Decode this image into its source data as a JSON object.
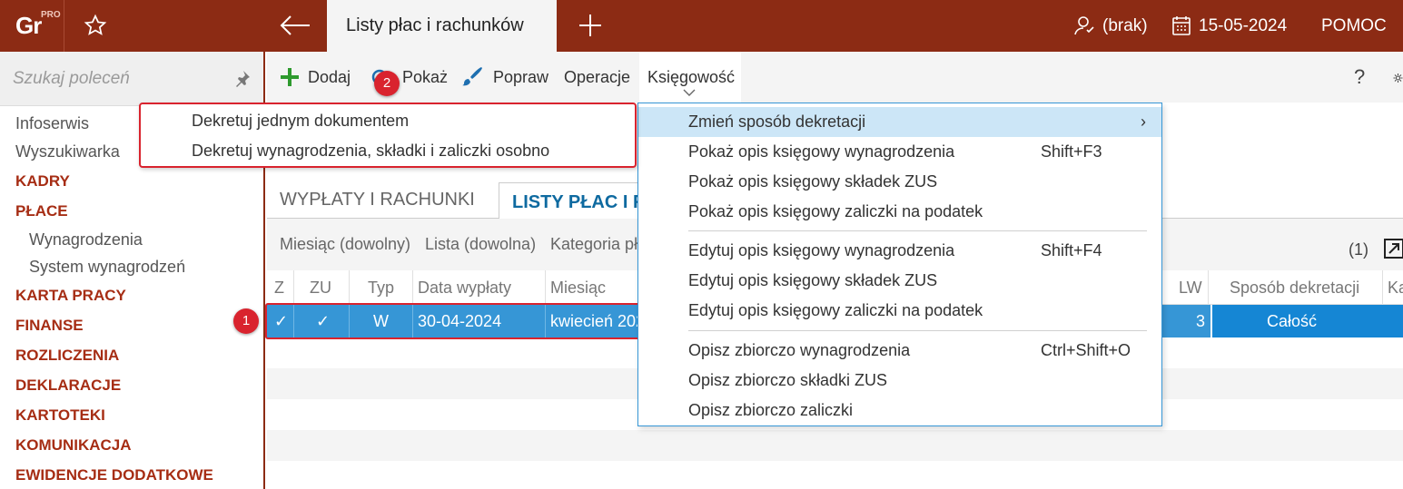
{
  "topbar": {
    "logo_main": "Gr",
    "logo_badge": "PRO",
    "active_tab": "Listy płac i rachunków",
    "user": "(brak)",
    "date": "15-05-2024",
    "help": "POMOC"
  },
  "sidebar": {
    "search_placeholder": "Szukaj poleceń",
    "items": [
      {
        "label": "Infoserwis"
      },
      {
        "label": "Wyszukiwarka"
      },
      {
        "label": "KADRY"
      },
      {
        "label": "PŁACE"
      },
      {
        "label": "Wynagrodzenia"
      },
      {
        "label": "System wynagrodzeń"
      },
      {
        "label": "KARTA PRACY"
      },
      {
        "label": "FINANSE"
      },
      {
        "label": "ROZLICZENIA"
      },
      {
        "label": "DEKLARACJE"
      },
      {
        "label": "KARTOTEKI"
      },
      {
        "label": "KOMUNIKACJA"
      },
      {
        "label": "EWIDENCJE DODATKOWE"
      }
    ]
  },
  "toolbar": {
    "add": "Dodaj",
    "show": "Pokaż",
    "edit": "Popraw",
    "operations": "Operacje",
    "accounting": "Księgowość",
    "help": "?"
  },
  "tabs": {
    "payments": "WYPŁATY I RACHUNKI",
    "lists": "LISTY PŁAC I R"
  },
  "filters": {
    "month": "Miesiąc (dowolny)",
    "list": "Lista (dowolna)",
    "category": "Kategoria pł",
    "count": "(1)"
  },
  "grid": {
    "headers": {
      "z": "Z",
      "zu": "ZU",
      "type": "Typ",
      "payment_date": "Data wypłaty",
      "month": "Miesiąc",
      "lw": "LW",
      "method": "Sposób dekretacji",
      "k": "Ka"
    },
    "row": {
      "z": "✓",
      "zu": "✓",
      "type": "W",
      "payment_date": "30-04-2024",
      "month": "kwiecień 202",
      "lw": "3",
      "method": "Całość"
    }
  },
  "menu": {
    "items": [
      {
        "label": "Zmień sposób dekretacji",
        "shortcut": "",
        "submenu": "›"
      },
      {
        "label": "Pokaż opis księgowy wynagrodzenia",
        "shortcut": "Shift+F3"
      },
      {
        "label": "Pokaż opis księgowy składek ZUS",
        "shortcut": ""
      },
      {
        "label": "Pokaż opis księgowy zaliczki na podatek",
        "shortcut": ""
      },
      {
        "label": "Edytuj opis księgowy wynagrodzenia",
        "shortcut": "Shift+F4"
      },
      {
        "label": "Edytuj opis księgowy składek ZUS",
        "shortcut": ""
      },
      {
        "label": "Edytuj opis księgowy zaliczki na podatek",
        "shortcut": ""
      },
      {
        "label": "Opisz zbiorczo wynagrodzenia",
        "shortcut": "Ctrl+Shift+O"
      },
      {
        "label": "Opisz zbiorczo składki ZUS",
        "shortcut": ""
      },
      {
        "label": "Opisz zbiorczo zaliczki",
        "shortcut": ""
      }
    ]
  },
  "submenu": {
    "items": [
      {
        "label": "Dekretuj jednym dokumentem"
      },
      {
        "label": "Dekretuj wynagrodzenia, składki i zaliczki osobno"
      }
    ]
  },
  "badges": {
    "one": "1",
    "two": "2"
  },
  "colors": {
    "brand": "#8c2b14",
    "accent": "#a62d14",
    "selection": "#3696d6",
    "highlight": "#d9232e"
  }
}
